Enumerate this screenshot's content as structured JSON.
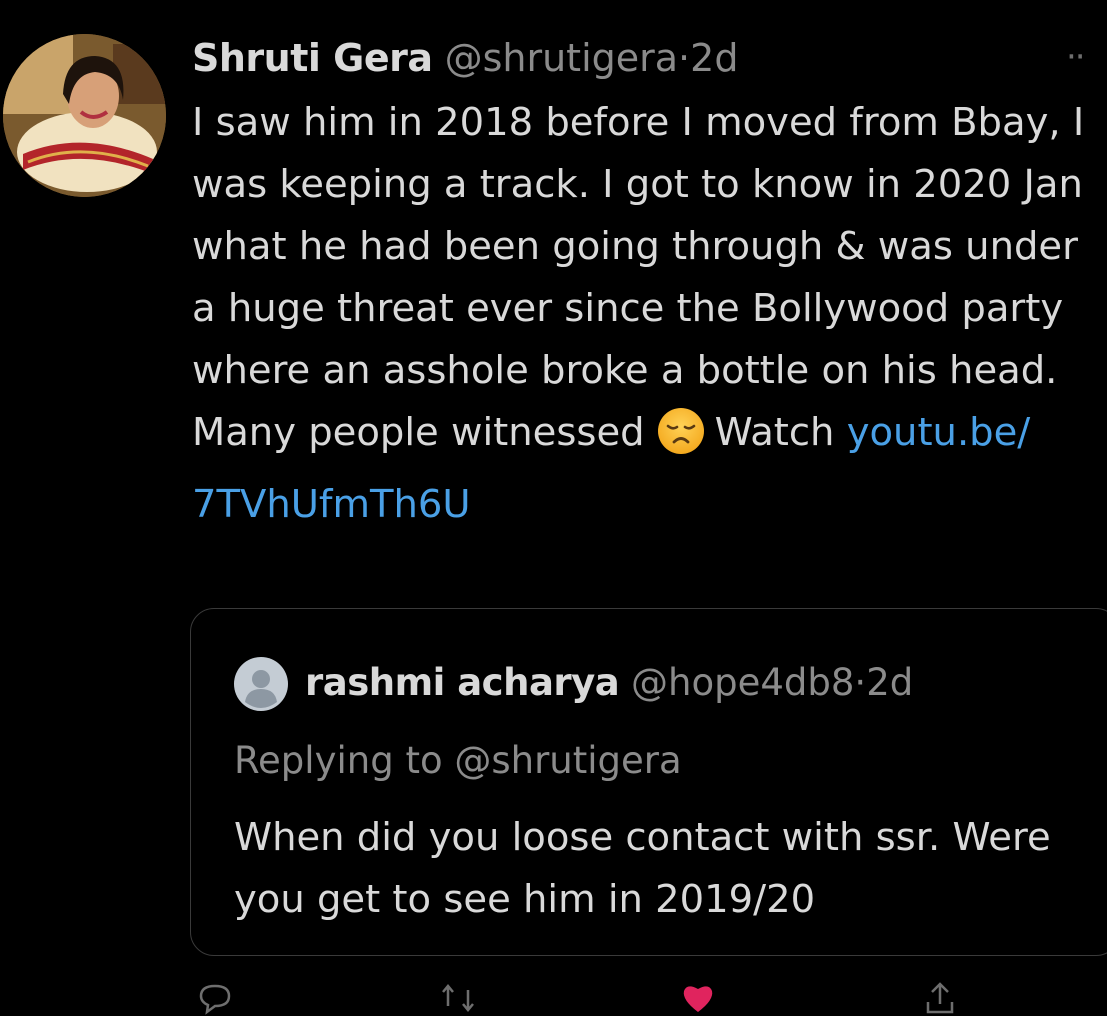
{
  "tweet": {
    "author_name": "Shruti Gera",
    "author_handle": "@shrutigera",
    "separator": "·",
    "time": "2d",
    "more_label": "··",
    "text_before_emoji": "I saw him in 2018 before I moved from Bbay, I was keeping a track. I got to know in 2020 Jan what he had been going through & was under a huge threat ever since the Bollywood party where an asshole broke a bottle on his head. Many people witnessed",
    "emoji": "disappointed-face-icon",
    "text_after_emoji": "Watch ",
    "link_text": "youtu.be/ 7TVhUfmTh6U"
  },
  "quoted_tweet": {
    "author_name": "rashmi acharya",
    "author_handle": "@hope4db8",
    "separator": "·",
    "time": "2d",
    "replying_to": "Replying to @shrutigera",
    "text": "When did you loose contact with ssr. Were you get to see him in 2019/20"
  },
  "actions": {
    "icons": [
      "reply-icon",
      "retweet-icon",
      "like-icon",
      "share-icon"
    ]
  },
  "colors": {
    "background": "#000000",
    "text": "#d9d9d9",
    "secondary": "#8b8b8b",
    "link": "#4aa0e6",
    "border": "#3a3a3a",
    "like": "#e0245e"
  }
}
